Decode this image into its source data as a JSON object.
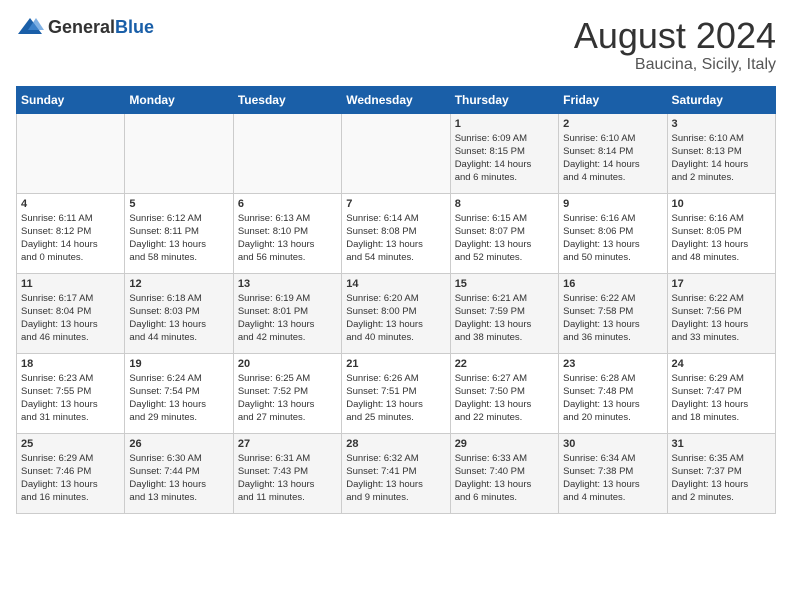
{
  "header": {
    "logo_general": "General",
    "logo_blue": "Blue",
    "month": "August 2024",
    "location": "Baucina, Sicily, Italy"
  },
  "days_of_week": [
    "Sunday",
    "Monday",
    "Tuesday",
    "Wednesday",
    "Thursday",
    "Friday",
    "Saturday"
  ],
  "weeks": [
    [
      {
        "day": "",
        "info": ""
      },
      {
        "day": "",
        "info": ""
      },
      {
        "day": "",
        "info": ""
      },
      {
        "day": "",
        "info": ""
      },
      {
        "day": "1",
        "info": "Sunrise: 6:09 AM\nSunset: 8:15 PM\nDaylight: 14 hours\nand 6 minutes."
      },
      {
        "day": "2",
        "info": "Sunrise: 6:10 AM\nSunset: 8:14 PM\nDaylight: 14 hours\nand 4 minutes."
      },
      {
        "day": "3",
        "info": "Sunrise: 6:10 AM\nSunset: 8:13 PM\nDaylight: 14 hours\nand 2 minutes."
      }
    ],
    [
      {
        "day": "4",
        "info": "Sunrise: 6:11 AM\nSunset: 8:12 PM\nDaylight: 14 hours\nand 0 minutes."
      },
      {
        "day": "5",
        "info": "Sunrise: 6:12 AM\nSunset: 8:11 PM\nDaylight: 13 hours\nand 58 minutes."
      },
      {
        "day": "6",
        "info": "Sunrise: 6:13 AM\nSunset: 8:10 PM\nDaylight: 13 hours\nand 56 minutes."
      },
      {
        "day": "7",
        "info": "Sunrise: 6:14 AM\nSunset: 8:08 PM\nDaylight: 13 hours\nand 54 minutes."
      },
      {
        "day": "8",
        "info": "Sunrise: 6:15 AM\nSunset: 8:07 PM\nDaylight: 13 hours\nand 52 minutes."
      },
      {
        "day": "9",
        "info": "Sunrise: 6:16 AM\nSunset: 8:06 PM\nDaylight: 13 hours\nand 50 minutes."
      },
      {
        "day": "10",
        "info": "Sunrise: 6:16 AM\nSunset: 8:05 PM\nDaylight: 13 hours\nand 48 minutes."
      }
    ],
    [
      {
        "day": "11",
        "info": "Sunrise: 6:17 AM\nSunset: 8:04 PM\nDaylight: 13 hours\nand 46 minutes."
      },
      {
        "day": "12",
        "info": "Sunrise: 6:18 AM\nSunset: 8:03 PM\nDaylight: 13 hours\nand 44 minutes."
      },
      {
        "day": "13",
        "info": "Sunrise: 6:19 AM\nSunset: 8:01 PM\nDaylight: 13 hours\nand 42 minutes."
      },
      {
        "day": "14",
        "info": "Sunrise: 6:20 AM\nSunset: 8:00 PM\nDaylight: 13 hours\nand 40 minutes."
      },
      {
        "day": "15",
        "info": "Sunrise: 6:21 AM\nSunset: 7:59 PM\nDaylight: 13 hours\nand 38 minutes."
      },
      {
        "day": "16",
        "info": "Sunrise: 6:22 AM\nSunset: 7:58 PM\nDaylight: 13 hours\nand 36 minutes."
      },
      {
        "day": "17",
        "info": "Sunrise: 6:22 AM\nSunset: 7:56 PM\nDaylight: 13 hours\nand 33 minutes."
      }
    ],
    [
      {
        "day": "18",
        "info": "Sunrise: 6:23 AM\nSunset: 7:55 PM\nDaylight: 13 hours\nand 31 minutes."
      },
      {
        "day": "19",
        "info": "Sunrise: 6:24 AM\nSunset: 7:54 PM\nDaylight: 13 hours\nand 29 minutes."
      },
      {
        "day": "20",
        "info": "Sunrise: 6:25 AM\nSunset: 7:52 PM\nDaylight: 13 hours\nand 27 minutes."
      },
      {
        "day": "21",
        "info": "Sunrise: 6:26 AM\nSunset: 7:51 PM\nDaylight: 13 hours\nand 25 minutes."
      },
      {
        "day": "22",
        "info": "Sunrise: 6:27 AM\nSunset: 7:50 PM\nDaylight: 13 hours\nand 22 minutes."
      },
      {
        "day": "23",
        "info": "Sunrise: 6:28 AM\nSunset: 7:48 PM\nDaylight: 13 hours\nand 20 minutes."
      },
      {
        "day": "24",
        "info": "Sunrise: 6:29 AM\nSunset: 7:47 PM\nDaylight: 13 hours\nand 18 minutes."
      }
    ],
    [
      {
        "day": "25",
        "info": "Sunrise: 6:29 AM\nSunset: 7:46 PM\nDaylight: 13 hours\nand 16 minutes."
      },
      {
        "day": "26",
        "info": "Sunrise: 6:30 AM\nSunset: 7:44 PM\nDaylight: 13 hours\nand 13 minutes."
      },
      {
        "day": "27",
        "info": "Sunrise: 6:31 AM\nSunset: 7:43 PM\nDaylight: 13 hours\nand 11 minutes."
      },
      {
        "day": "28",
        "info": "Sunrise: 6:32 AM\nSunset: 7:41 PM\nDaylight: 13 hours\nand 9 minutes."
      },
      {
        "day": "29",
        "info": "Sunrise: 6:33 AM\nSunset: 7:40 PM\nDaylight: 13 hours\nand 6 minutes."
      },
      {
        "day": "30",
        "info": "Sunrise: 6:34 AM\nSunset: 7:38 PM\nDaylight: 13 hours\nand 4 minutes."
      },
      {
        "day": "31",
        "info": "Sunrise: 6:35 AM\nSunset: 7:37 PM\nDaylight: 13 hours\nand 2 minutes."
      }
    ]
  ]
}
